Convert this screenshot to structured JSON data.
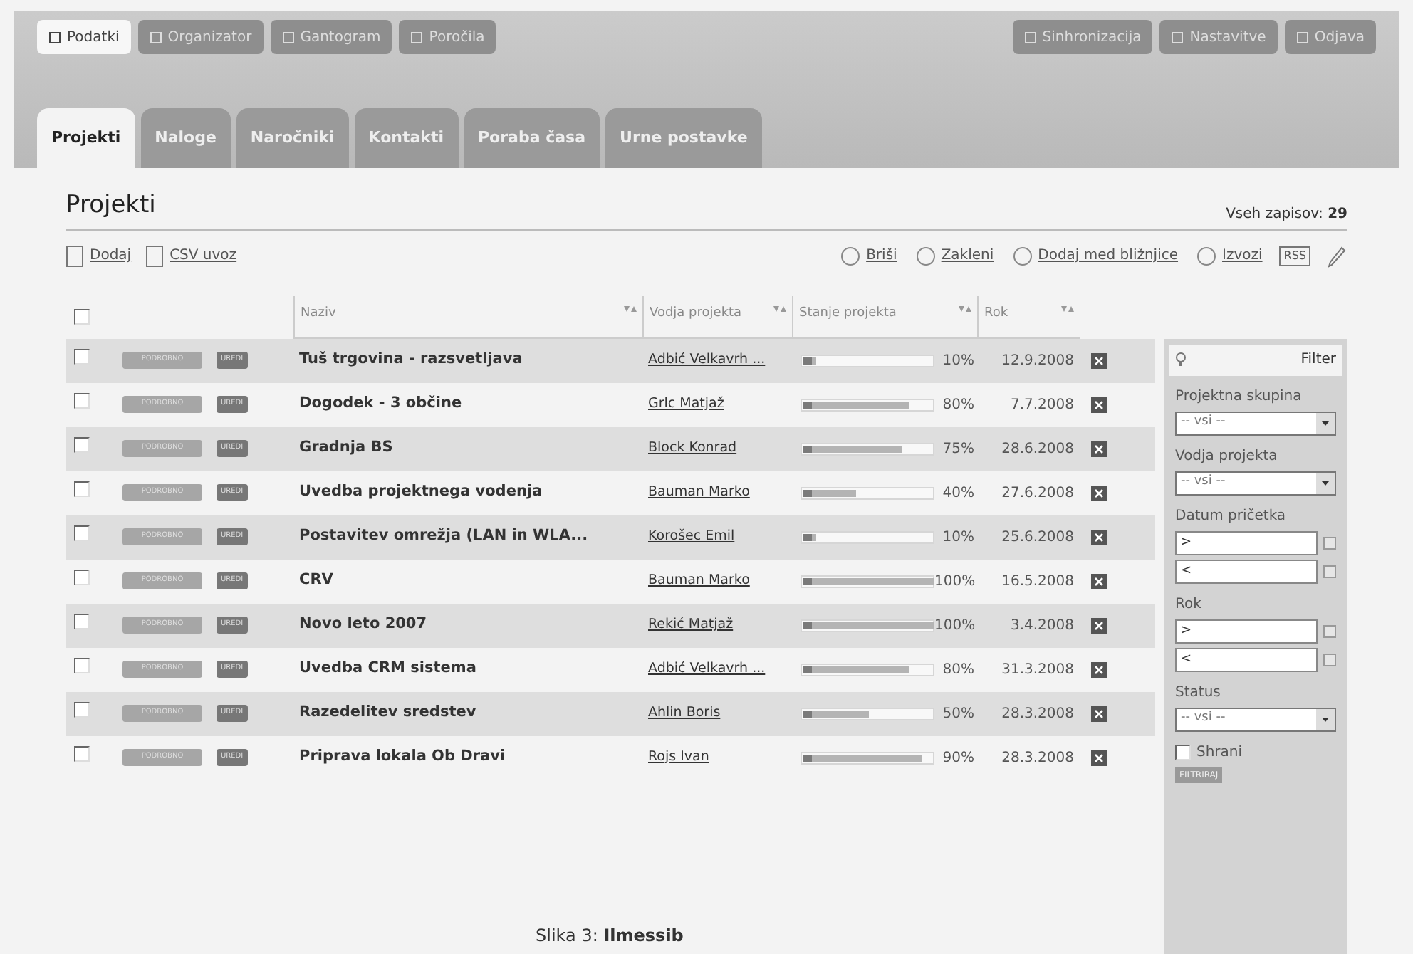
{
  "top_nav": [
    {
      "label": "Podatki",
      "selected": true
    },
    {
      "label": "Organizator",
      "selected": false
    },
    {
      "label": "Gantogram",
      "selected": false
    },
    {
      "label": "Poročila",
      "selected": false
    }
  ],
  "top_actions": [
    "Sinhronizacija",
    "Nastavitve",
    "Odjava"
  ],
  "tabs": [
    {
      "label": "Projekti",
      "selected": true
    },
    {
      "label": "Naloge",
      "selected": false
    },
    {
      "label": "Naročniki",
      "selected": false
    },
    {
      "label": "Kontakti",
      "selected": false
    },
    {
      "label": "Poraba časa",
      "selected": false
    },
    {
      "label": "Urne postavke",
      "selected": false
    }
  ],
  "page_title": "Projekti",
  "record_count_label": "Vseh zapisov:",
  "record_count": "29",
  "toolbar_left": [
    "Dodaj",
    "CSV uvoz"
  ],
  "toolbar_right": [
    "Briši",
    "Zakleni",
    "Dodaj med bližnjice",
    "Izvozi"
  ],
  "rss": "RSS",
  "table": {
    "select_all_checked": false,
    "columns": [
      "Naziv",
      "Vodja projekta",
      "Stanje projekta",
      "Rok"
    ],
    "rows": [
      {
        "checked": false,
        "details": "PODROBNO",
        "edit": "UREDI",
        "name": "Tuš trgovina - razsvetljava",
        "lead": "Adbić Velkavrh ...",
        "level": 0.1,
        "percent": "10%",
        "due": "12.9.2008"
      },
      {
        "checked": false,
        "details": "PODROBNO",
        "edit": "UREDI",
        "name": "Dogodek - 3 občine",
        "lead": "Grlc Matjaž",
        "level": 0.8,
        "percent": "80%",
        "due": "7.7.2008"
      },
      {
        "checked": false,
        "details": "PODROBNO",
        "edit": "UREDI",
        "name": "Gradnja BS",
        "lead": "Block Konrad",
        "level": 0.75,
        "percent": "75%",
        "due": "28.6.2008"
      },
      {
        "checked": false,
        "details": "PODROBNO",
        "edit": "UREDI",
        "name": "Uvedba projektnega vodenja",
        "lead": "Bauman Marko",
        "level": 0.4,
        "percent": "40%",
        "due": "27.6.2008"
      },
      {
        "checked": false,
        "details": "PODROBNO",
        "edit": "UREDI",
        "name": "Postavitev omrežja (LAN in WLA...",
        "lead": "Korošec Emil",
        "level": 0.1,
        "percent": "10%",
        "due": "25.6.2008"
      },
      {
        "checked": false,
        "details": "PODROBNO",
        "edit": "UREDI",
        "name": "CRV",
        "lead": "Bauman Marko",
        "level": 1,
        "percent": "100%",
        "due": "16.5.2008"
      },
      {
        "checked": false,
        "details": "PODROBNO",
        "edit": "UREDI",
        "name": "Novo leto 2007",
        "lead": "Rekić Matjaž",
        "level": 1,
        "percent": "100%",
        "due": "3.4.2008"
      },
      {
        "checked": false,
        "details": "PODROBNO",
        "edit": "UREDI",
        "name": "Uvedba CRM sistema",
        "lead": "Adbić Velkavrh ...",
        "level": 0.8,
        "percent": "80%",
        "due": "31.3.2008"
      },
      {
        "checked": false,
        "details": "PODROBNO",
        "edit": "UREDI",
        "name": "Razedelitev sredstev",
        "lead": "Ahlin Boris",
        "level": 0.5,
        "percent": "50%",
        "due": "28.3.2008"
      },
      {
        "checked": false,
        "details": "PODROBNO",
        "edit": "UREDI",
        "name": "Priprava lokala Ob Dravi",
        "lead": "Rojs Ivan",
        "level": 0.9,
        "percent": "90%",
        "due": "28.3.2008"
      }
    ]
  },
  "filter": {
    "title": "Filter",
    "fields": [
      {
        "kind": "select",
        "label": "Projektna skupina",
        "value": "-- vsi --"
      },
      {
        "kind": "select",
        "label": "Vodja projekta",
        "value": "-- vsi --"
      },
      {
        "kind": "range",
        "label": "Datum pričetka",
        "from_value": ">",
        "to_value": "<"
      },
      {
        "kind": "range",
        "label": "Rok",
        "from_value": ">",
        "to_value": "<"
      },
      {
        "kind": "select",
        "label": "Status",
        "value": "-- vsi --"
      }
    ],
    "save_label": "Shrani",
    "save_checked": false,
    "button": "FILTRIRAJ"
  },
  "caption": "Slika 3: **Ilmessib**"
}
